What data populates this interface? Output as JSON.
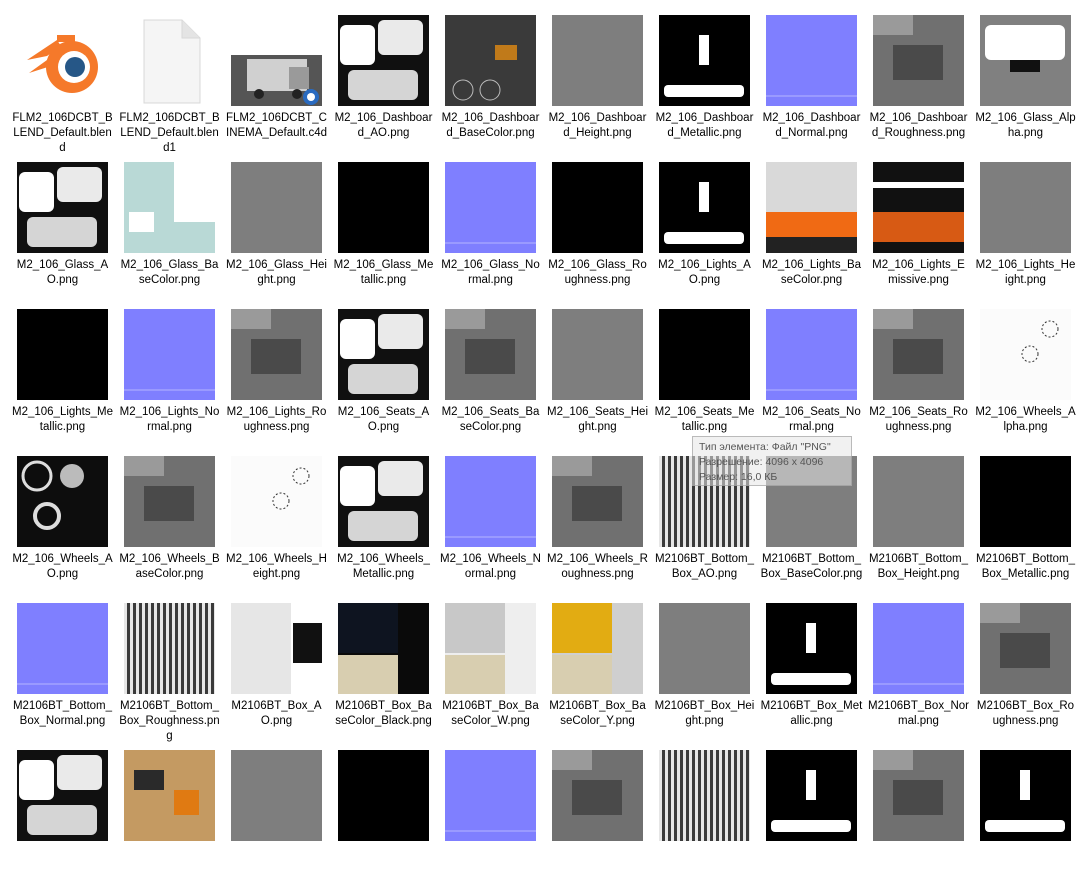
{
  "files": [
    {
      "name": "FLM2_106DCBT_BLEND_Default.blend",
      "kind": "blender-icon"
    },
    {
      "name": "FLM2_106DCBT_BLEND_Default.blend1",
      "kind": "generic-file-icon"
    },
    {
      "name": "FLM2_106DCBT_CINEMA_Default.c4d",
      "kind": "truck-preview"
    },
    {
      "name": "M2_106_Dashboard_AO.png",
      "kind": "ao"
    },
    {
      "name": "M2_106_Dashboard_BaseColor.png",
      "kind": "dash-base"
    },
    {
      "name": "M2_106_Dashboard_Height.png",
      "kind": "gray"
    },
    {
      "name": "M2_106_Dashboard_Metallic.png",
      "kind": "black-white"
    },
    {
      "name": "M2_106_Dashboard_Normal.png",
      "kind": "normal"
    },
    {
      "name": "M2_106_Dashboard_Roughness.png",
      "kind": "gray-rough"
    },
    {
      "name": "M2_106_Glass_Alpha.png",
      "kind": "alpha-gray"
    },
    {
      "name": "M2_106_Glass_AO.png",
      "kind": "ao"
    },
    {
      "name": "M2_106_Glass_BaseColor.png",
      "kind": "glass-base"
    },
    {
      "name": "M2_106_Glass_Height.png",
      "kind": "gray"
    },
    {
      "name": "M2_106_Glass_Metallic.png",
      "kind": "black"
    },
    {
      "name": "M2_106_Glass_Normal.png",
      "kind": "normal"
    },
    {
      "name": "M2_106_Glass_Roughness.png",
      "kind": "black"
    },
    {
      "name": "M2_106_Lights_AO.png",
      "kind": "black-white"
    },
    {
      "name": "M2_106_Lights_BaseColor.png",
      "kind": "lights-base"
    },
    {
      "name": "M2_106_Lights_Emissive.png",
      "kind": "lights-emissive"
    },
    {
      "name": "M2_106_Lights_Height.png",
      "kind": "gray"
    },
    {
      "name": "M2_106_Lights_Metallic.png",
      "kind": "black"
    },
    {
      "name": "M2_106_Lights_Normal.png",
      "kind": "normal"
    },
    {
      "name": "M2_106_Lights_Roughness.png",
      "kind": "gray-rough"
    },
    {
      "name": "M2_106_Seats_AO.png",
      "kind": "ao"
    },
    {
      "name": "M2_106_Seats_BaseColor.png",
      "kind": "gray-rough"
    },
    {
      "name": "M2_106_Seats_Height.png",
      "kind": "gray"
    },
    {
      "name": "M2_106_Seats_Metallic.png",
      "kind": "black"
    },
    {
      "name": "M2_106_Seats_Normal.png",
      "kind": "normal"
    },
    {
      "name": "M2_106_Seats_Roughness.png",
      "kind": "gray-rough"
    },
    {
      "name": "M2_106_Wheels_Alpha.png",
      "kind": "white-dots"
    },
    {
      "name": "M2_106_Wheels_AO.png",
      "kind": "wheels-ao"
    },
    {
      "name": "M2_106_Wheels_BaseColor.png",
      "kind": "gray-rough"
    },
    {
      "name": "M2_106_Wheels_Height.png",
      "kind": "white-dots"
    },
    {
      "name": "M2_106_Wheels_Metallic.png",
      "kind": "ao"
    },
    {
      "name": "M2_106_Wheels_Normal.png",
      "kind": "normal"
    },
    {
      "name": "M2_106_Wheels_Roughness.png",
      "kind": "gray-rough"
    },
    {
      "name": "M2106BT_Bottom_Box_AO.png",
      "kind": "stripes"
    },
    {
      "name": "M2106BT_Bottom_Box_BaseColor.png",
      "kind": "gray"
    },
    {
      "name": "M2106BT_Bottom_Box_Height.png",
      "kind": "gray"
    },
    {
      "name": "M2106BT_Bottom_Box_Metallic.png",
      "kind": "black"
    },
    {
      "name": "M2106BT_Bottom_Box_Normal.png",
      "kind": "normal"
    },
    {
      "name": "M2106BT_Bottom_Box_Roughness.png",
      "kind": "stripes"
    },
    {
      "name": "M2106BT_Box_AO.png",
      "kind": "box-ao"
    },
    {
      "name": "M2106BT_Box_BaseColor_Black.png",
      "kind": "box-black"
    },
    {
      "name": "M2106BT_Box_BaseColor_W.png",
      "kind": "box-white"
    },
    {
      "name": "M2106BT_Box_BaseColor_Y.png",
      "kind": "box-yellow"
    },
    {
      "name": "M2106BT_Box_Height.png",
      "kind": "gray"
    },
    {
      "name": "M2106BT_Box_Metallic.png",
      "kind": "black-white"
    },
    {
      "name": "M2106BT_Box_Normal.png",
      "kind": "normal"
    },
    {
      "name": "M2106BT_Box_Roughness.png",
      "kind": "gray-rough"
    },
    {
      "name": "",
      "kind": "ao"
    },
    {
      "name": "",
      "kind": "box-base"
    },
    {
      "name": "",
      "kind": "gray"
    },
    {
      "name": "",
      "kind": "black"
    },
    {
      "name": "",
      "kind": "normal"
    },
    {
      "name": "",
      "kind": "gray-rough"
    },
    {
      "name": "",
      "kind": "stripes"
    },
    {
      "name": "",
      "kind": "black-white"
    },
    {
      "name": "",
      "kind": "gray-rough"
    },
    {
      "name": "",
      "kind": "black-white"
    }
  ],
  "tooltip": {
    "line1": "Тип элемента: Файл \"PNG\"",
    "line2": "Разрешение: 4096 x 4096",
    "line3": "Размер: 16,0 КБ"
  },
  "colors": {
    "normal_map": "#7f7fff",
    "blender_orange": "#f5792a",
    "blender_blue": "#265787"
  }
}
